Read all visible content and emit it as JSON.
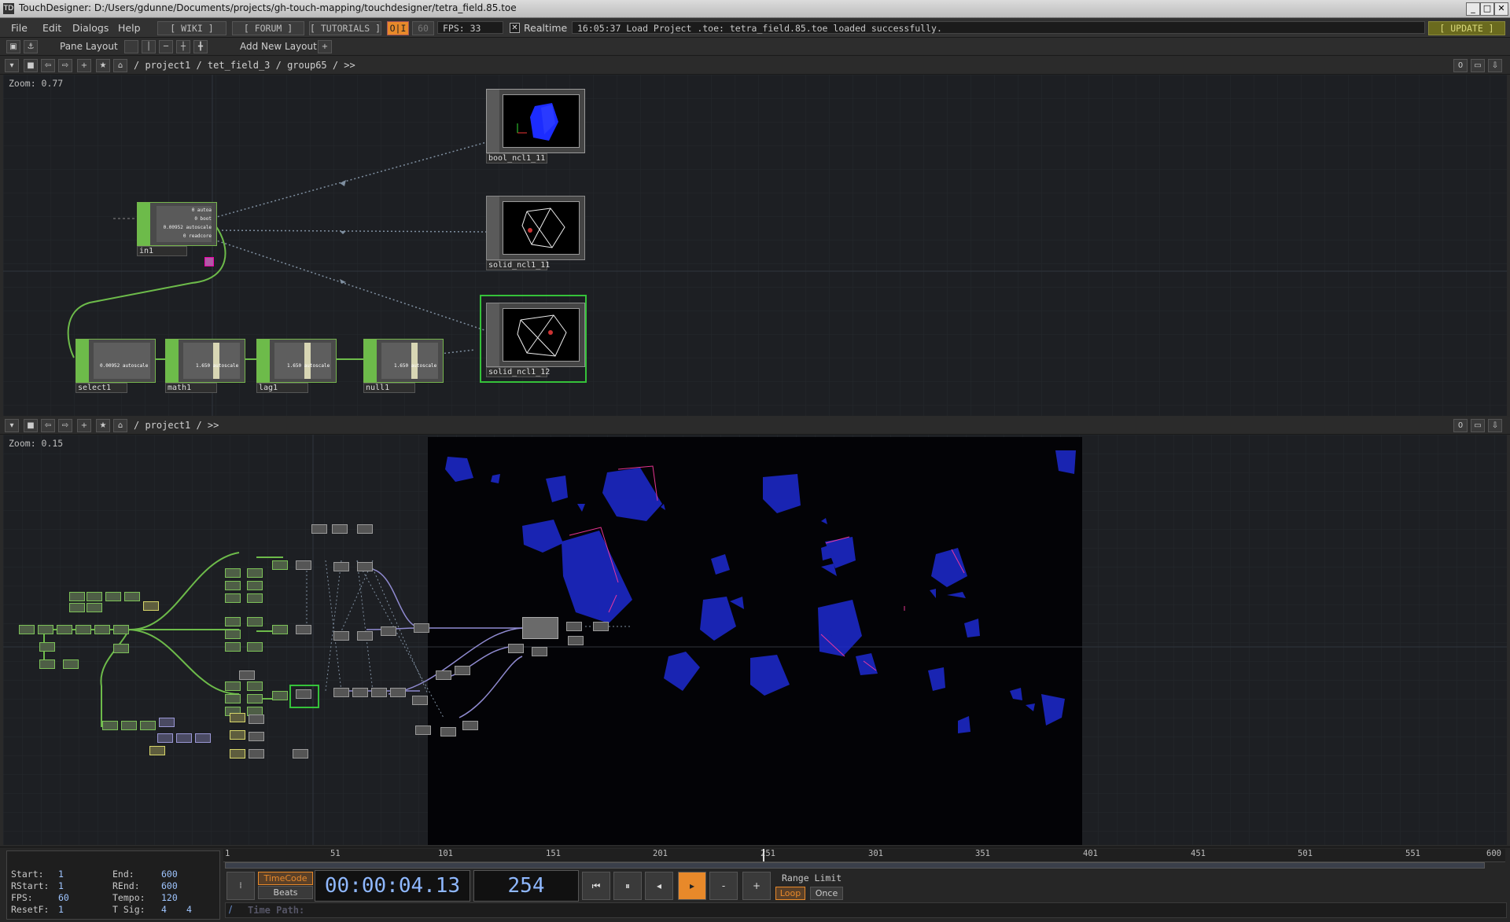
{
  "window": {
    "title": "TouchDesigner: D:/Users/gdunne/Documents/projects/gh-touch-mapping/touchdesigner/tetra_field.85.toe",
    "app_icon": "TD"
  },
  "menu": {
    "items": [
      "File",
      "Edit",
      "Dialogs",
      "Help"
    ],
    "wiki": "[ WIKI ]",
    "forum": "[ FORUM ]",
    "tutorials": "[ TUTORIALS ]",
    "oi": "O|I",
    "fps_target": "60",
    "fps_label": "FPS: 33",
    "realtime": "Realtime",
    "status": "16:05:37 Load Project .toe: tetra_field.85.toe loaded successfully.",
    "update": "[ UPDATE ]"
  },
  "toolbar": {
    "pane_layout": "Pane Layout",
    "add_new_layout": "Add New Layout",
    "plus": "+"
  },
  "pane_top": {
    "path": "/ project1 / tet_field_3 / group65 / >>",
    "zoom": "Zoom: 0.77",
    "count": "0"
  },
  "pane_bottom": {
    "path": "/ project1 / >>",
    "zoom": "Zoom: 0.15",
    "count": "0"
  },
  "nodes_top": {
    "in1": {
      "name": "in1",
      "lines": [
        "0 autoa",
        "0 boot",
        "0.00952 autoscale",
        "0 readcore"
      ]
    },
    "select1": {
      "name": "select1",
      "value": "0.00952 autoscale"
    },
    "math1": {
      "name": "math1",
      "value": "1.650 autoscale"
    },
    "lag1": {
      "name": "lag1",
      "value": "1.650 autoscale"
    },
    "null1": {
      "name": "null1",
      "value": "1.650 autoscale"
    },
    "bool": {
      "name": "bool_ncl1_11"
    },
    "solid11": {
      "name": "solid_ncl1_11"
    },
    "solid12": {
      "name": "solid_ncl1_12"
    }
  },
  "timeline": {
    "start_label": "Start:",
    "start": "1",
    "end_label": "End:",
    "end": "600",
    "rstart_label": "RStart:",
    "rstart": "1",
    "rend_label": "REnd:",
    "rend": "600",
    "fps_label": "FPS:",
    "fps": "60",
    "tempo_label": "Tempo:",
    "tempo": "120",
    "resetf_label": "ResetF:",
    "resetf": "1",
    "tsig_label": "T Sig:",
    "tsig_a": "4",
    "tsig_b": "4",
    "ruler": [
      "1",
      "51",
      "101",
      "151",
      "201",
      "251",
      "301",
      "351",
      "401",
      "451",
      "501",
      "551",
      "600"
    ],
    "timecode_label": "TimeCode",
    "beats_label": "Beats",
    "timecode": "00:00:04.13",
    "frame": "254",
    "range_limit": "Range Limit",
    "loop": "Loop",
    "once": "Once",
    "time_path": "Time Path:",
    "minus": "-",
    "plus": "+"
  },
  "colors": {
    "accent_orange": "#e8892a",
    "chop_green": "#6dbb4a",
    "selected_green": "#35c23a",
    "render_blue": "#2230d8"
  }
}
